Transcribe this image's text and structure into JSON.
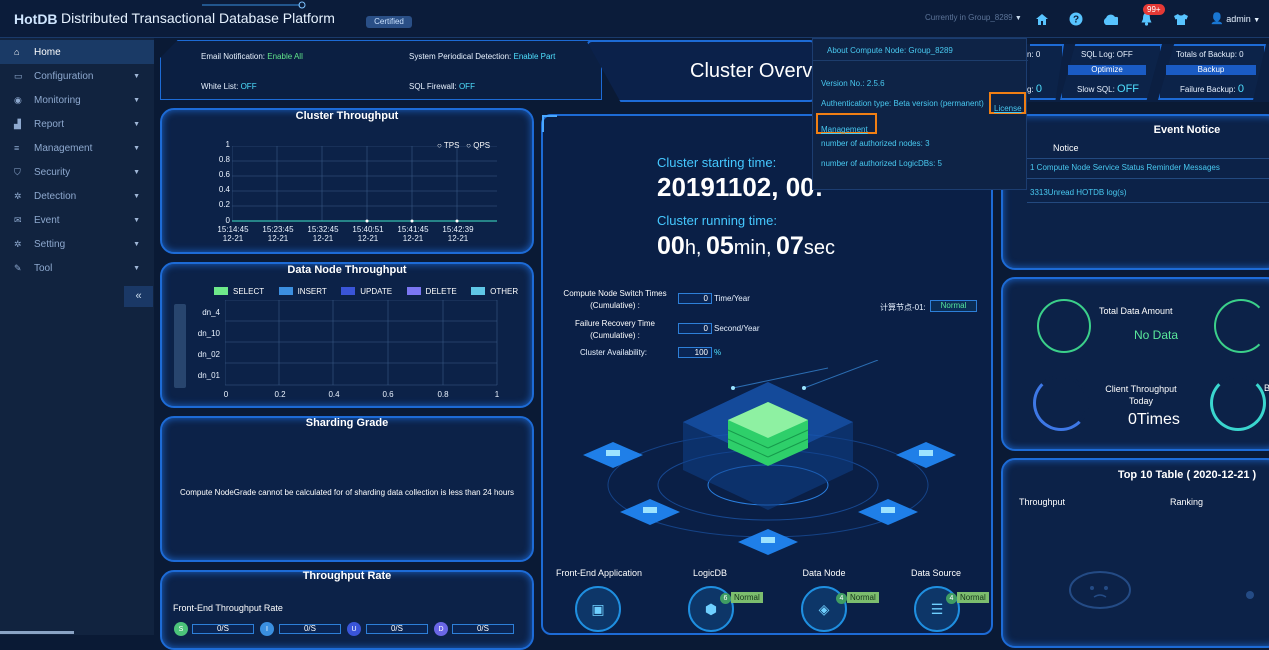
{
  "header": {
    "logo": "HotDB",
    "title": "Distributed Transactional Database Platform",
    "certified": "Certified",
    "group": "Currently in Group_8289",
    "badge": "99+",
    "user": "admin"
  },
  "sidebar": {
    "items": [
      {
        "label": "Home",
        "icon": "home-icon"
      },
      {
        "label": "Configuration",
        "icon": "monitor-icon"
      },
      {
        "label": "Monitoring",
        "icon": "eye-icon"
      },
      {
        "label": "Report",
        "icon": "chart-icon"
      },
      {
        "label": "Management",
        "icon": "database-icon"
      },
      {
        "label": "Security",
        "icon": "shield-icon"
      },
      {
        "label": "Detection",
        "icon": "gear-icon"
      },
      {
        "label": "Event",
        "icon": "mail-icon"
      },
      {
        "label": "Setting",
        "icon": "cog-icon"
      },
      {
        "label": "Tool",
        "icon": "wrench-icon"
      }
    ],
    "collapse": "«"
  },
  "status": {
    "email_label": "Email Notification:",
    "email_value": "Enable All",
    "detect_label": "System Periodical Detection:",
    "detect_value": "Enable Part",
    "whitelist_label": "White List:",
    "whitelist_value": "OFF",
    "firewall_label": "SQL Firewall:",
    "firewall_value": "OFF"
  },
  "throughput": {
    "title": "Cluster Throughput",
    "legend": [
      "TPS",
      "QPS"
    ],
    "y_ticks": [
      "1",
      "0.8",
      "0.6",
      "0.4",
      "0.2",
      "0"
    ],
    "x_ticks": [
      [
        "15:14:45",
        "12-21"
      ],
      [
        "15:23:45",
        "12-21"
      ],
      [
        "15:32:45",
        "12-21"
      ],
      [
        "15:40:51",
        "12-21"
      ],
      [
        "15:41:45",
        "12-21"
      ],
      [
        "15:42:39",
        "12-21"
      ]
    ]
  },
  "datanode": {
    "title": "Data Node Throughput",
    "legend": [
      {
        "label": "SELECT",
        "color": "#6ee98a"
      },
      {
        "label": "INSERT",
        "color": "#3c8fe0"
      },
      {
        "label": "UPDATE",
        "color": "#3a55d8"
      },
      {
        "label": "DELETE",
        "color": "#7b76f2"
      },
      {
        "label": "OTHER",
        "color": "#5fc7e6"
      }
    ],
    "rows": [
      "dn_4",
      "dn_10",
      "dn_02",
      "dn_01"
    ],
    "x_ticks": [
      "0",
      "0.2",
      "0.4",
      "0.6",
      "0.8",
      "1"
    ]
  },
  "sharding": {
    "title": "Sharding Grade",
    "message": "Compute NodeGrade cannot be calculated for of sharding data collection is less than 24 hours"
  },
  "rate": {
    "title": "Throughput Rate",
    "subtitle": "Front-End Throughput Rate",
    "items": [
      {
        "letter": "S",
        "value": "0/S",
        "color": "#4bc37a"
      },
      {
        "letter": "I",
        "value": "0/S",
        "color": "#3a8fe0"
      },
      {
        "letter": "U",
        "value": "0/S",
        "color": "#3a55d8"
      },
      {
        "letter": "D",
        "value": "0/S",
        "color": "#6a66e6"
      }
    ]
  },
  "center": {
    "title": "Cluster Overv",
    "start_label": "Cluster starting time:",
    "start_value": "20191102, 00:",
    "run_label": "Cluster running time:",
    "run_h": "00",
    "run_h_unit": "h,",
    "run_m": "05",
    "run_m_unit": "min,",
    "run_s": "07",
    "run_s_unit": "sec",
    "switch_label1": "Compute Node Switch Times",
    "switch_label2": "(Cumulative) :",
    "switch_value": "0",
    "switch_unit": "Time/Year",
    "recovery_label1": "Failure Recovery Time",
    "recovery_label2": "(Cumulative) :",
    "recovery_value": "0",
    "recovery_unit": "Second/Year",
    "avail_label": "Cluster Availability:",
    "avail_value": "100",
    "avail_unit": "%",
    "node_label": "计算节点-01:",
    "node_status": "Normal",
    "components": [
      {
        "label": "Front-End Application",
        "count": "",
        "status": ""
      },
      {
        "label": "LogicDB",
        "count": "6",
        "status": "Normal"
      },
      {
        "label": "Data Node",
        "count": "4",
        "status": "Normal"
      },
      {
        "label": "Data Source",
        "count": "4",
        "status": "Normal"
      }
    ]
  },
  "popup": {
    "title": "About Compute Node:  Group_8289",
    "version": "Version No.: 2.5.6",
    "auth": "Authentication type: Beta version (permanent)",
    "license": "License",
    "management": "Management",
    "nodes": "number of authorized nodes: 3",
    "logicdbs": "number of authorized LogicDBs: 5"
  },
  "topright": {
    "a_label": "n:",
    "a_value": "0",
    "sqllog_label": "SQL Log:",
    "sqllog_value": "OFF",
    "optimize": "Optimize",
    "b_label": "g:",
    "b_value": "0",
    "slowsql_label": "Slow SQL:",
    "slowsql_value": "OFF",
    "backup_total_label": "Totals of Backup:",
    "backup_total_value": "0",
    "backup": "Backup",
    "fail_backup_label": "Failure Backup:",
    "fail_backup_value": "0"
  },
  "events": {
    "title": "Event Notice",
    "notice": "Notice",
    "items": [
      "1 Compute Node Service Status Reminder Messages",
      "3313Unread HOTDB log(s)"
    ]
  },
  "stats": {
    "data_label": "Total Data Amount",
    "data_value": "No Data",
    "client_label1": "Client Throughput",
    "client_label2": "Today",
    "client_value": "0Times",
    "b_char": "B"
  },
  "top10": {
    "title": "Top 10 Table ( 2020-12-21 )",
    "col1": "Throughput",
    "col2": "Ranking"
  }
}
